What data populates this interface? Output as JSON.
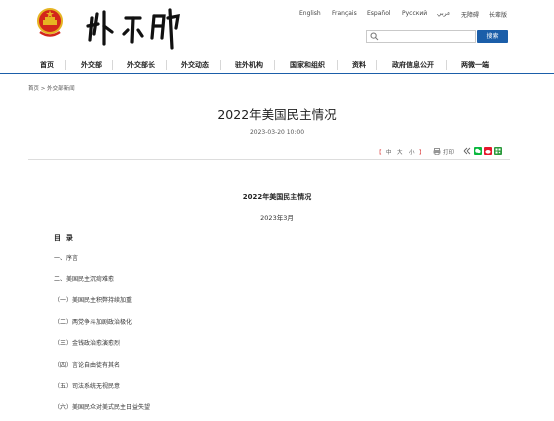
{
  "header": {
    "languages": [
      "English",
      "Français",
      "Español",
      "Русский",
      "عربي",
      "无障碍",
      "长辈版"
    ],
    "search": {
      "placeholder": "",
      "button_label": "搜索"
    }
  },
  "nav": {
    "items": [
      "首页",
      "外交部",
      "外交部长",
      "外交动态",
      "驻外机构",
      "国家和组织",
      "资料",
      "政府信息公开",
      "两微一端"
    ]
  },
  "breadcrumb": "首页 > 外交部新闻",
  "article": {
    "title": "2022年美国民主情况",
    "date": "2023-03-20 10:00",
    "tools": {
      "bracket_open": "【",
      "zh": "中",
      "da": "大",
      "xiao": "小",
      "bracket_close": "】",
      "print": "打印"
    },
    "doc_title": "2022年美国民主情况",
    "doc_date": "2023年3月",
    "toc_heading": "目  录",
    "toc": [
      "一、序言",
      "二、美国民主沉疴难愈",
      "（一）美国民主积弊持续加重",
      "（二）两党争斗加剧政治极化",
      "（三）金钱政治愈演愈烈",
      "（四）言论自由徒有其名",
      "（五）司法系统无视民意",
      "（六）美国民众对美式民主日益失望"
    ]
  },
  "colors": {
    "accent": "#1b5ea9",
    "emblem_red": "#d3261b",
    "emblem_gold": "#e6b422"
  }
}
